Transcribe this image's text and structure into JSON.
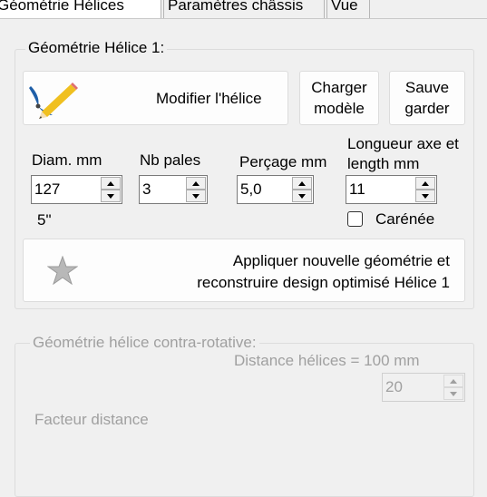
{
  "tabs": [
    {
      "label": "Géométrie Hélices",
      "active": true
    },
    {
      "label": "Paramètres châssis",
      "active": false
    },
    {
      "label": "Vue",
      "active": false
    }
  ],
  "helice1": {
    "group_title": "Géométrie Hélice 1:",
    "modify_button": "Modifier l'hélice",
    "load_model_button": "Charger modèle",
    "save_button": "Sauve garder",
    "diam_label": "Diam. mm",
    "diam_value": "127",
    "diam_inches": "5\"",
    "blades_label": "Nb pales",
    "blades_value": "3",
    "bore_label": "Perçage mm",
    "bore_value": "5,0",
    "axis_label_line1": "Longueur axe et",
    "axis_label_line2": "length mm",
    "axis_value": "11",
    "ducted_label": "Carénée",
    "ducted_checked": false,
    "apply_line1": "Appliquer nouvelle géométrie et",
    "apply_line2": "reconstruire design optimisé Hélice 1"
  },
  "contra": {
    "group_title": "Géométrie hélice contra-rotative:",
    "distance_label": "Distance hélices = 100 mm",
    "distance_value": "20",
    "factor_label": "Facteur distance"
  },
  "icons": {
    "modify": "propeller-pencil-icon",
    "apply": "star-icon"
  }
}
